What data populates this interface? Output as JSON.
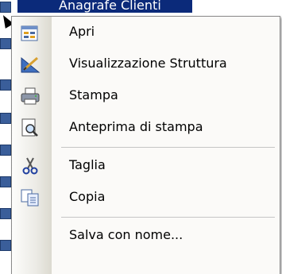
{
  "background": {
    "selected_object_label": "Anagrafe Clienti"
  },
  "menu": {
    "items": [
      {
        "label": "Apri",
        "icon": "open-form-icon"
      },
      {
        "label": "Visualizzazione Struttura",
        "icon": "design-view-icon"
      },
      {
        "label": "Stampa",
        "icon": "printer-icon"
      },
      {
        "label": "Anteprima di stampa",
        "icon": "print-preview-icon"
      },
      {
        "label": "Taglia",
        "icon": "scissors-icon"
      },
      {
        "label": "Copia",
        "icon": "copy-icon"
      },
      {
        "label": "Salva con nome...",
        "icon": ""
      }
    ]
  },
  "colors": {
    "menu_bg": "#fbfaf8",
    "selection": "#0b2a7a"
  }
}
